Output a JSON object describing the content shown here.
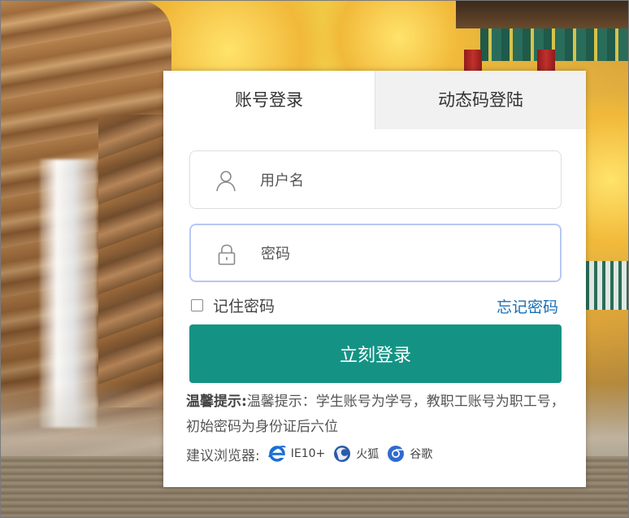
{
  "tabs": {
    "account_login": "账号登录",
    "dynamic_code_login": "动态码登陆"
  },
  "form": {
    "username_placeholder": "用户名",
    "password_placeholder": "密码",
    "remember_label": "记住密码",
    "remember_checked": false,
    "forgot_label": "忘记密码",
    "submit_label": "立刻登录"
  },
  "tip": {
    "title": "温馨提示:",
    "text": "温馨提示：学生账号为学号，教职工账号为职工号，初始密码为身份证后六位"
  },
  "browsers": {
    "label": "建议浏览器:",
    "items": [
      {
        "name": "IE10+",
        "icon": "ie-icon",
        "color": "#1c6fd1"
      },
      {
        "name": "火狐",
        "icon": "firefox-icon",
        "color": "#2a5aa8"
      },
      {
        "name": "谷歌",
        "icon": "chrome-icon",
        "color": "#2f6bd0"
      }
    ]
  },
  "colors": {
    "primary": "#149385",
    "link": "#1a6fb5",
    "focus_border": "#b7c8f5"
  }
}
